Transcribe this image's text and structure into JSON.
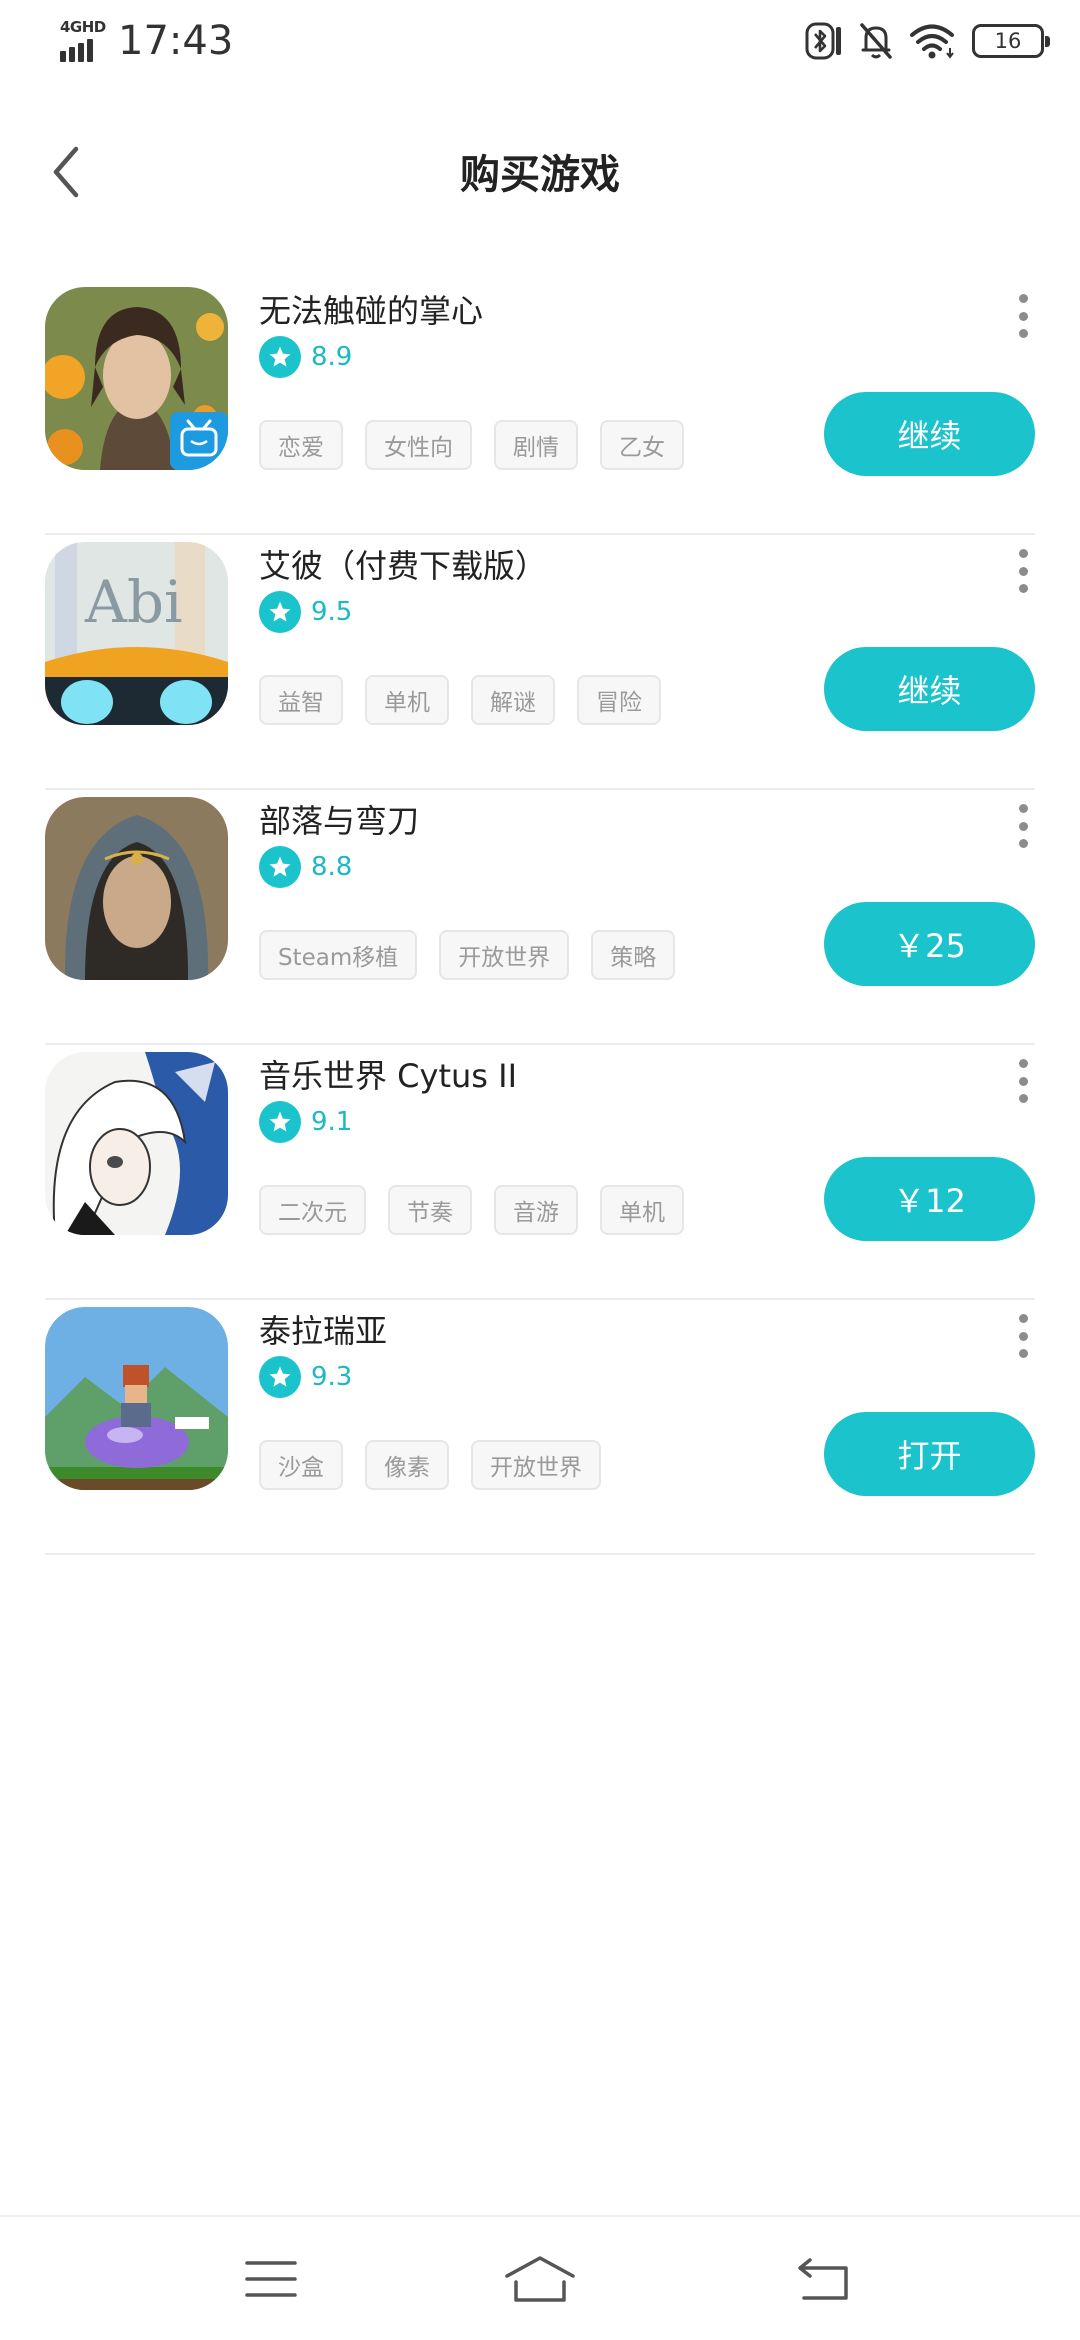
{
  "status_bar": {
    "network": "4GHD",
    "time": "17:43",
    "battery": "16"
  },
  "header": {
    "title": "购买游戏"
  },
  "games": [
    {
      "name": "无法触碰的掌心",
      "rating": "8.9",
      "tags": [
        "恋爱",
        "女性向",
        "剧情",
        "乙女"
      ],
      "action": "继续"
    },
    {
      "name": "艾彼（付费下载版）",
      "rating": "9.5",
      "tags": [
        "益智",
        "单机",
        "解谜",
        "冒险"
      ],
      "action": "继续"
    },
    {
      "name": "部落与弯刀",
      "rating": "8.8",
      "tags": [
        "Steam移植",
        "开放世界",
        "策略"
      ],
      "action": "￥25"
    },
    {
      "name": "音乐世界 Cytus II",
      "rating": "9.1",
      "tags": [
        "二次元",
        "节奏",
        "音游",
        "单机"
      ],
      "action": "￥12"
    },
    {
      "name": "泰拉瑞亚",
      "rating": "9.3",
      "tags": [
        "沙盒",
        "像素",
        "开放世界"
      ],
      "action": "打开"
    }
  ],
  "theme": {
    "accent": "#1bc3cc",
    "tag_text": "#9a9a9a",
    "divider": "#ececec"
  },
  "icons": {
    "back": "chevron-left-icon",
    "more": "more-vertical-icon",
    "star": "star-icon",
    "nav_menu": "menu-icon",
    "nav_home": "home-icon",
    "nav_back": "return-icon"
  }
}
